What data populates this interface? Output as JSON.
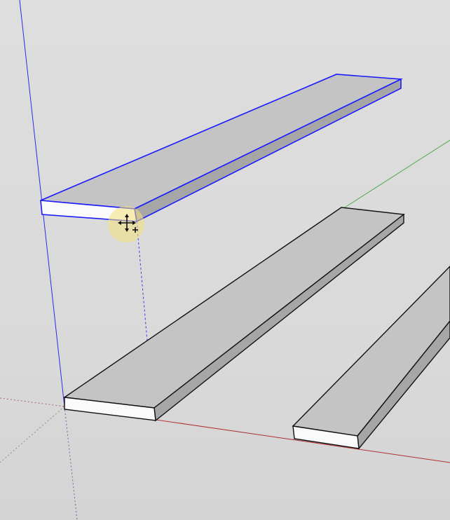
{
  "app": {
    "type": "3d-modeling-viewport"
  },
  "scene": {
    "background_color": "#dcdcdc",
    "selection_color": "#1a1aff",
    "edge_color": "#111111",
    "top_face_color": "#c4c4c4",
    "front_face_color": "#fafafa",
    "side_face_color": "#a6a6a6",
    "axes": {
      "red_axis_color": "#b03030",
      "green_axis_color": "#4aaa4a",
      "blue_axis_color": "#2a2aee"
    },
    "objects": [
      {
        "name": "board-selected",
        "selected": true
      },
      {
        "name": "board-left",
        "selected": false
      },
      {
        "name": "board-right",
        "selected": false
      }
    ],
    "cursor": {
      "tool": "move-tool",
      "highlight_color": "#f4e27a"
    }
  }
}
